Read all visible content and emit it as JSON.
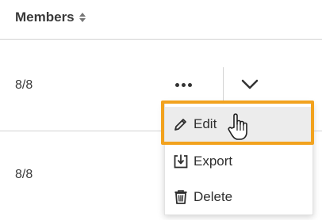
{
  "table": {
    "column_header": "Members",
    "rows": [
      {
        "members": "8/8"
      },
      {
        "members": "8/8"
      }
    ]
  },
  "menu": {
    "items": [
      {
        "label": "Edit",
        "icon": "pencil-icon"
      },
      {
        "label": "Export",
        "icon": "export-icon"
      },
      {
        "label": "Delete",
        "icon": "trash-icon"
      }
    ]
  },
  "colors": {
    "highlight": "#f2a21e",
    "hover_bg": "#ececec",
    "divider": "#d2d2d2"
  }
}
